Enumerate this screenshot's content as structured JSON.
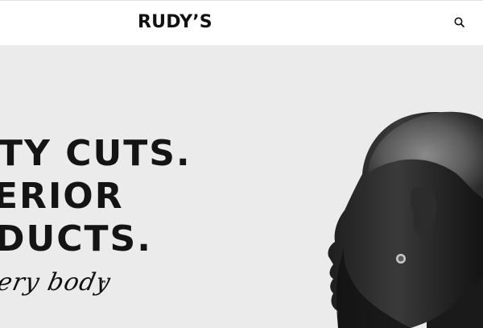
{
  "header": {
    "logo_text": "RUDY’S",
    "search_icon": "search-icon"
  },
  "hero": {
    "headline_lines": [
      "TY CUTS.",
      "ERIOR",
      "DUCTS."
    ],
    "tagline": "ery body",
    "tagline_mark": "™",
    "image": "portrait-of-man-profile"
  }
}
